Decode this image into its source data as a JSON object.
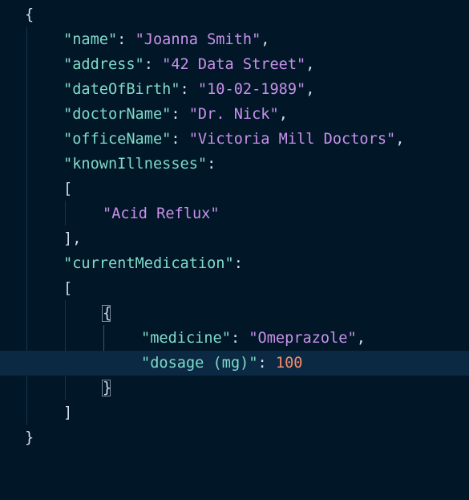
{
  "editor": {
    "theme_colors": {
      "background": "#011627",
      "key": "#7fdbca",
      "string": "#c792ea",
      "number": "#f78c6c",
      "punctuation": "#d6deeb",
      "current_line": "#0b2942"
    },
    "lines": [
      {
        "open": "{"
      },
      {
        "key": "\"name\"",
        "sep": ": ",
        "value": "\"Joanna Smith\"",
        "end": ","
      },
      {
        "key": "\"address\"",
        "sep": ": ",
        "value": "\"42 Data Street\"",
        "end": ","
      },
      {
        "key": "\"dateOfBirth\"",
        "sep": ": ",
        "value": "\"10-02-1989\"",
        "end": ","
      },
      {
        "key": "\"doctorName\"",
        "sep": ": ",
        "value": "\"Dr. Nick\"",
        "end": ","
      },
      {
        "key": "\"officeName\"",
        "sep": ": ",
        "value": "\"Victoria Mill Doctors\"",
        "end": ","
      },
      {
        "key": "\"knownIllnesses\"",
        "sep": ":"
      },
      {
        "open": "["
      },
      {
        "value": "\"Acid Reflux\""
      },
      {
        "close": "],"
      },
      {
        "key": "\"currentMedication\"",
        "sep": ":"
      },
      {
        "open": "["
      },
      {
        "open": "{"
      },
      {
        "key": "\"medicine\"",
        "sep": ": ",
        "value": "\"Omeprazole\"",
        "end": ","
      },
      {
        "key": "\"dosage (mg)\"",
        "sep": ": ",
        "number": "100"
      },
      {
        "close": "}"
      },
      {
        "close": "]"
      },
      {
        "close": "}"
      }
    ]
  }
}
